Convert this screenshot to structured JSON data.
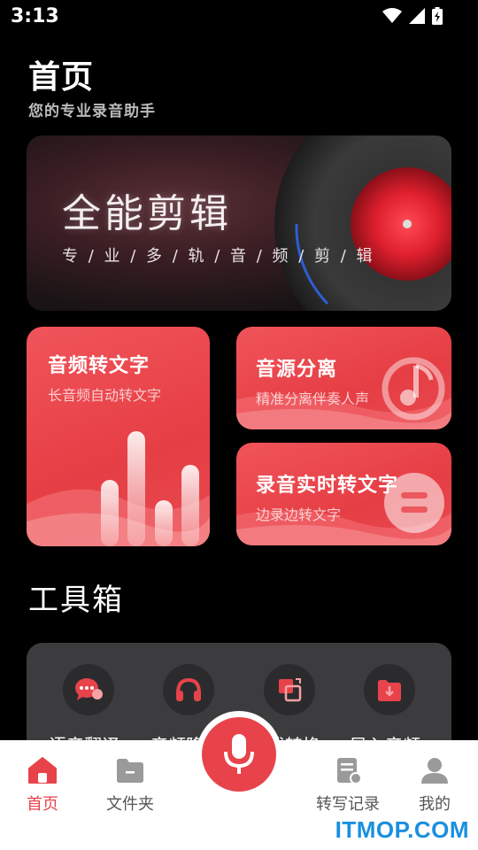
{
  "status_bar": {
    "time": "3:13",
    "icons": [
      "wifi-icon",
      "signal-icon",
      "battery-icon"
    ]
  },
  "header": {
    "title": "首页",
    "subtitle": "您的专业录音助手"
  },
  "banner": {
    "title": "全能剪辑",
    "subtitle": "专 / 业 / 多 / 轨 / 音 / 频 / 剪 / 辑"
  },
  "features": [
    {
      "title": "音频转文字",
      "desc": "长音频自动转文字"
    },
    {
      "title": "音源分离",
      "desc": "精准分离伴奏人声"
    },
    {
      "title": "录音实时转文字",
      "desc": "边录边转文字"
    }
  ],
  "toolbox": {
    "title": "工具箱",
    "tools": [
      {
        "label": "语音翻译",
        "icon": "chat-bubble-icon"
      },
      {
        "label": "音频降",
        "icon": "headphones-icon"
      },
      {
        "label": "格式转换",
        "icon": "convert-icon"
      },
      {
        "label": "导入音频",
        "icon": "import-folder-icon"
      }
    ]
  },
  "bottom_nav": {
    "items": [
      {
        "label": "首页",
        "icon": "home-icon",
        "active": true
      },
      {
        "label": "文件夹",
        "icon": "folder-icon",
        "active": false
      },
      {
        "label": "转写记录",
        "icon": "transcript-record-icon",
        "active": false
      },
      {
        "label": "我的",
        "icon": "user-icon",
        "active": false
      }
    ],
    "record_button_icon": "microphone-icon"
  },
  "watermark": "ITMOP.COM",
  "colors": {
    "accent": "#e8434a",
    "background": "#000000",
    "toolbox_bg": "#3c3c3e",
    "watermark": "#1a8fe0"
  }
}
